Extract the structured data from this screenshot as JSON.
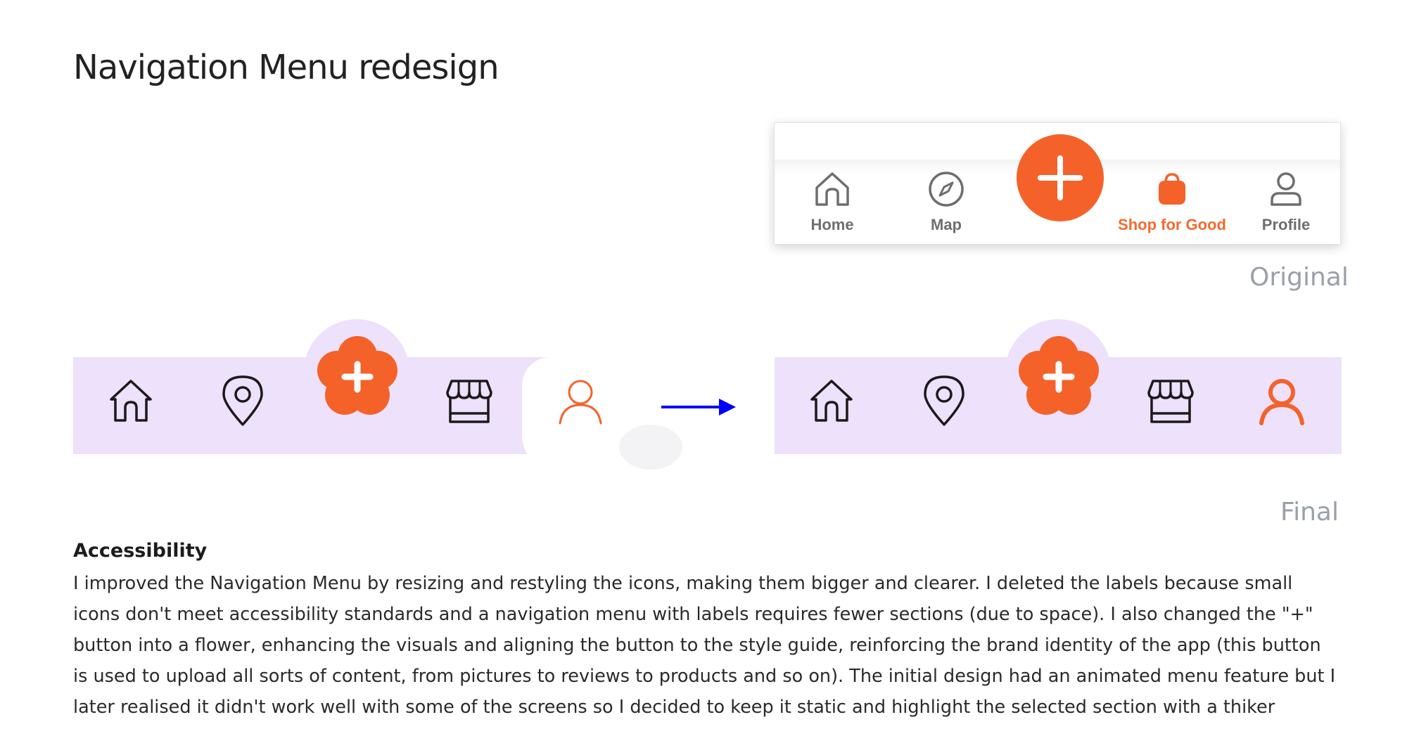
{
  "title": "Navigation Menu redesign",
  "original": {
    "caption": "Original",
    "items": [
      {
        "label": "Home",
        "icon": "home-icon",
        "active": false
      },
      {
        "label": "Map",
        "icon": "compass-icon",
        "active": false
      },
      {
        "label": "",
        "icon": "plus-icon",
        "active": false
      },
      {
        "label": "Shop for Good",
        "icon": "shopping-bag-icon",
        "active": true
      },
      {
        "label": "Profile",
        "icon": "profile-icon",
        "active": false
      }
    ]
  },
  "redesign": {
    "caption": "Final",
    "items": [
      {
        "icon": "home-icon"
      },
      {
        "icon": "location-pin-icon"
      },
      {
        "icon": "flower-plus-icon"
      },
      {
        "icon": "store-icon"
      },
      {
        "icon": "profile-icon"
      }
    ]
  },
  "colors": {
    "accent_orange": "#f4622a",
    "purple_bar": "#ede1fb",
    "arrow_blue": "#0000ff",
    "caption_gray": "#9aa0aa"
  },
  "accessibility": {
    "heading": "Accessibility",
    "body": "I improved the Navigation Menu by resizing and restyling the icons, making them bigger and clearer. I deleted the labels because small icons don't meet accessibility standards and a navigation menu with labels requires fewer sections (due to space). I also changed the \"+\" button into a flower, enhancing the visuals and aligning the button to the style guide, reinforcing the brand identity of the app (this button is used to upload all sorts of content, from pictures to reviews to products and so on). The initial design had an animated menu feature but I later realised it didn't work well with some of the screens so I decided to keep it static and highlight the selected section with a thiker orange stroke."
  }
}
